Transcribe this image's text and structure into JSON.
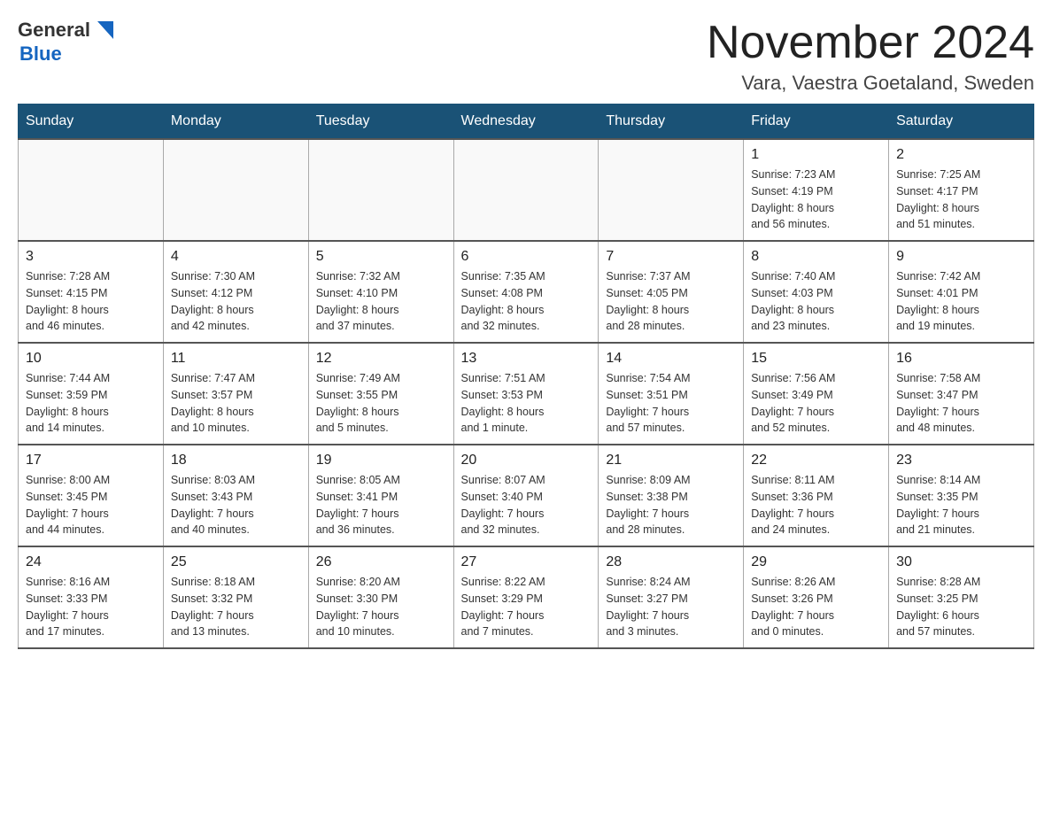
{
  "header": {
    "logo_general": "General",
    "logo_blue": "Blue",
    "month_title": "November 2024",
    "location": "Vara, Vaestra Goetaland, Sweden"
  },
  "days_of_week": [
    "Sunday",
    "Monday",
    "Tuesday",
    "Wednesday",
    "Thursday",
    "Friday",
    "Saturday"
  ],
  "weeks": [
    [
      {
        "day": "",
        "info": ""
      },
      {
        "day": "",
        "info": ""
      },
      {
        "day": "",
        "info": ""
      },
      {
        "day": "",
        "info": ""
      },
      {
        "day": "",
        "info": ""
      },
      {
        "day": "1",
        "info": "Sunrise: 7:23 AM\nSunset: 4:19 PM\nDaylight: 8 hours\nand 56 minutes."
      },
      {
        "day": "2",
        "info": "Sunrise: 7:25 AM\nSunset: 4:17 PM\nDaylight: 8 hours\nand 51 minutes."
      }
    ],
    [
      {
        "day": "3",
        "info": "Sunrise: 7:28 AM\nSunset: 4:15 PM\nDaylight: 8 hours\nand 46 minutes."
      },
      {
        "day": "4",
        "info": "Sunrise: 7:30 AM\nSunset: 4:12 PM\nDaylight: 8 hours\nand 42 minutes."
      },
      {
        "day": "5",
        "info": "Sunrise: 7:32 AM\nSunset: 4:10 PM\nDaylight: 8 hours\nand 37 minutes."
      },
      {
        "day": "6",
        "info": "Sunrise: 7:35 AM\nSunset: 4:08 PM\nDaylight: 8 hours\nand 32 minutes."
      },
      {
        "day": "7",
        "info": "Sunrise: 7:37 AM\nSunset: 4:05 PM\nDaylight: 8 hours\nand 28 minutes."
      },
      {
        "day": "8",
        "info": "Sunrise: 7:40 AM\nSunset: 4:03 PM\nDaylight: 8 hours\nand 23 minutes."
      },
      {
        "day": "9",
        "info": "Sunrise: 7:42 AM\nSunset: 4:01 PM\nDaylight: 8 hours\nand 19 minutes."
      }
    ],
    [
      {
        "day": "10",
        "info": "Sunrise: 7:44 AM\nSunset: 3:59 PM\nDaylight: 8 hours\nand 14 minutes."
      },
      {
        "day": "11",
        "info": "Sunrise: 7:47 AM\nSunset: 3:57 PM\nDaylight: 8 hours\nand 10 minutes."
      },
      {
        "day": "12",
        "info": "Sunrise: 7:49 AM\nSunset: 3:55 PM\nDaylight: 8 hours\nand 5 minutes."
      },
      {
        "day": "13",
        "info": "Sunrise: 7:51 AM\nSunset: 3:53 PM\nDaylight: 8 hours\nand 1 minute."
      },
      {
        "day": "14",
        "info": "Sunrise: 7:54 AM\nSunset: 3:51 PM\nDaylight: 7 hours\nand 57 minutes."
      },
      {
        "day": "15",
        "info": "Sunrise: 7:56 AM\nSunset: 3:49 PM\nDaylight: 7 hours\nand 52 minutes."
      },
      {
        "day": "16",
        "info": "Sunrise: 7:58 AM\nSunset: 3:47 PM\nDaylight: 7 hours\nand 48 minutes."
      }
    ],
    [
      {
        "day": "17",
        "info": "Sunrise: 8:00 AM\nSunset: 3:45 PM\nDaylight: 7 hours\nand 44 minutes."
      },
      {
        "day": "18",
        "info": "Sunrise: 8:03 AM\nSunset: 3:43 PM\nDaylight: 7 hours\nand 40 minutes."
      },
      {
        "day": "19",
        "info": "Sunrise: 8:05 AM\nSunset: 3:41 PM\nDaylight: 7 hours\nand 36 minutes."
      },
      {
        "day": "20",
        "info": "Sunrise: 8:07 AM\nSunset: 3:40 PM\nDaylight: 7 hours\nand 32 minutes."
      },
      {
        "day": "21",
        "info": "Sunrise: 8:09 AM\nSunset: 3:38 PM\nDaylight: 7 hours\nand 28 minutes."
      },
      {
        "day": "22",
        "info": "Sunrise: 8:11 AM\nSunset: 3:36 PM\nDaylight: 7 hours\nand 24 minutes."
      },
      {
        "day": "23",
        "info": "Sunrise: 8:14 AM\nSunset: 3:35 PM\nDaylight: 7 hours\nand 21 minutes."
      }
    ],
    [
      {
        "day": "24",
        "info": "Sunrise: 8:16 AM\nSunset: 3:33 PM\nDaylight: 7 hours\nand 17 minutes."
      },
      {
        "day": "25",
        "info": "Sunrise: 8:18 AM\nSunset: 3:32 PM\nDaylight: 7 hours\nand 13 minutes."
      },
      {
        "day": "26",
        "info": "Sunrise: 8:20 AM\nSunset: 3:30 PM\nDaylight: 7 hours\nand 10 minutes."
      },
      {
        "day": "27",
        "info": "Sunrise: 8:22 AM\nSunset: 3:29 PM\nDaylight: 7 hours\nand 7 minutes."
      },
      {
        "day": "28",
        "info": "Sunrise: 8:24 AM\nSunset: 3:27 PM\nDaylight: 7 hours\nand 3 minutes."
      },
      {
        "day": "29",
        "info": "Sunrise: 8:26 AM\nSunset: 3:26 PM\nDaylight: 7 hours\nand 0 minutes."
      },
      {
        "day": "30",
        "info": "Sunrise: 8:28 AM\nSunset: 3:25 PM\nDaylight: 6 hours\nand 57 minutes."
      }
    ]
  ]
}
